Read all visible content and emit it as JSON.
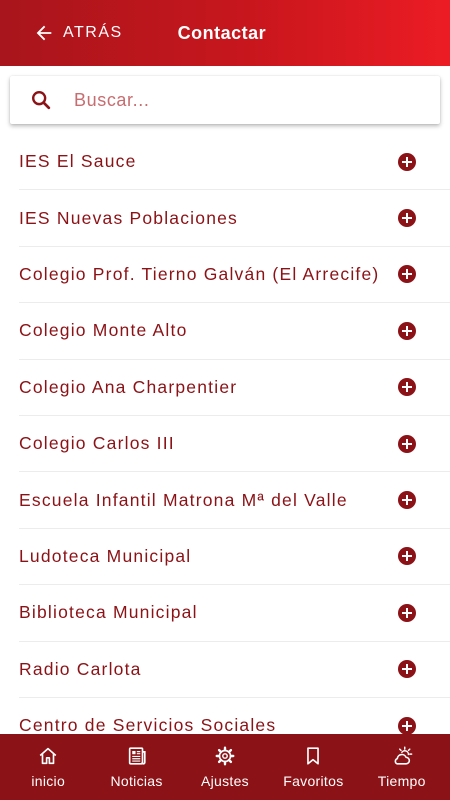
{
  "header": {
    "back_label": "ATRÁS",
    "title": "Contactar"
  },
  "search": {
    "placeholder": "Buscar...",
    "value": ""
  },
  "items": [
    {
      "label": "IES El Sauce"
    },
    {
      "label": "IES Nuevas Poblaciones"
    },
    {
      "label": "Colegio Prof. Tierno Galván (El Arrecife)"
    },
    {
      "label": "Colegio Monte Alto"
    },
    {
      "label": "Colegio Ana Charpentier"
    },
    {
      "label": "Colegio Carlos III"
    },
    {
      "label": "Escuela Infantil Matrona Mª del Valle"
    },
    {
      "label": "Ludoteca Municipal"
    },
    {
      "label": "Biblioteca Municipal"
    },
    {
      "label": "Radio Carlota"
    },
    {
      "label": "Centro de Servicios Sociales"
    }
  ],
  "nav": [
    {
      "label": "inicio",
      "icon": "home-icon"
    },
    {
      "label": "Noticias",
      "icon": "newspaper-icon"
    },
    {
      "label": "Ajustes",
      "icon": "gear-icon"
    },
    {
      "label": "Favoritos",
      "icon": "bookmark-icon"
    },
    {
      "label": "Tiempo",
      "icon": "weather-icon"
    }
  ],
  "colors": {
    "header_start": "#a8151c",
    "header_end": "#ec1c24",
    "primary": "#8b1216",
    "divider": "#ececec"
  }
}
